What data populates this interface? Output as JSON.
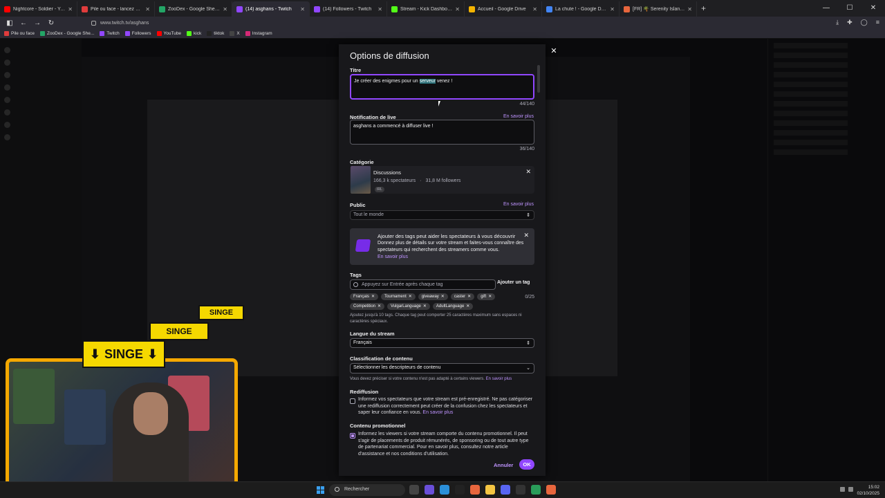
{
  "browser": {
    "tabs": [
      {
        "title": "Nightcore - Soldier - YouTu",
        "color": "#ff0000"
      },
      {
        "title": "Pile ou face - lancez une pièce",
        "color": "#e03c3c"
      },
      {
        "title": "ZooDex - Google Sheets",
        "color": "#23a566"
      },
      {
        "title": "(14) asghans - Twitch",
        "color": "#9147ff",
        "active": true
      },
      {
        "title": "(14) Followers - Twitch",
        "color": "#9147ff"
      },
      {
        "title": "Stream - Kick Dashboard",
        "color": "#53fc18"
      },
      {
        "title": "Accueil - Google Drive",
        "color": "#f4b400"
      },
      {
        "title": "La chute ! - Google Docs",
        "color": "#4285f4"
      },
      {
        "title": "[FR] 🌴 Serenity Island 🌴 | EI",
        "color": "#e8663d"
      }
    ],
    "url": "www.twitch.tv/asghans",
    "bookmarks": [
      {
        "label": "Pile ou face",
        "color": "#e03c3c"
      },
      {
        "label": "ZooDex - Google She...",
        "color": "#23a566"
      },
      {
        "label": "Twitch",
        "color": "#9147ff"
      },
      {
        "label": "Followers",
        "color": "#9147ff"
      },
      {
        "label": "YouTube",
        "color": "#ff0000"
      },
      {
        "label": "kick",
        "color": "#53fc18"
      },
      {
        "label": "tiktok",
        "color": "#222222"
      },
      {
        "label": "X",
        "color": "#444444"
      },
      {
        "label": "Instagram",
        "color": "#d62976"
      }
    ]
  },
  "overlay": {
    "singe_label": "SINGE"
  },
  "modal": {
    "title": "Options de diffusion",
    "title_field": {
      "label": "Titre",
      "value_before": "Je créer des enigmes pour un ",
      "value_highlight": "serveur",
      "value_after": " venez !",
      "counter": "44/140"
    },
    "notification": {
      "label": "Notification de live",
      "link": "En savoir plus",
      "value": "asghans a commencé à diffuser live !",
      "counter": "36/140"
    },
    "category": {
      "label": "Catégorie",
      "name": "Discussions",
      "viewers": "166,3 k spectateurs",
      "followers": "31,8 M followers",
      "tag": "IRL"
    },
    "audience": {
      "label": "Public",
      "link": "En savoir plus",
      "value": "Tout le monde"
    },
    "promo": {
      "title": "Ajouter des tags peut aider les spectateurs à vous découvrir",
      "body": "Donnez plus de détails sur votre stream et faites-vous connaître des spectateurs qui recherchent des streamers comme vous.",
      "link": "En savoir plus"
    },
    "tags": {
      "label": "Tags",
      "placeholder": "Appuyez sur Entrée après chaque tag",
      "add_button": "Ajouter un tag",
      "counter": "0/25",
      "items": [
        "Français",
        "Tournament",
        "giveaway",
        "caster",
        "gift",
        "Competition",
        "VulgarLanguage",
        "AdultLanguage"
      ],
      "hint": "Ajoutez jusqu'à 10 tags. Chaque tag peut comporter 25 caractères maximum sans espaces ni caractères spéciaux."
    },
    "language": {
      "label": "Langue du stream",
      "value": "Français"
    },
    "classification": {
      "label": "Classification de contenu",
      "value": "Sélectionner les descripteurs de contenu",
      "hint": "Vous devez préciser si votre contenu n'est pas adapté à certains viewers.",
      "hint_link": "En savoir plus"
    },
    "rerun": {
      "label": "Rediffusion",
      "text": "Informez vos spectateurs que votre stream est pré-enregistré. Ne pas catégoriser une rediffusion correctement peut créer de la confusion chez les spectateurs et saper leur confiance en vous.",
      "link": "En savoir plus"
    },
    "branded": {
      "label": "Contenu promotionnel",
      "text": "Informez les viewers si votre stream comporte du contenu promotionnel. Il peut s'agir de placements de produit rémunérés, de sponsoring ou de tout autre type de partenariat commercial. Pour en savoir plus, consultez notre article d'assistance et nos conditions d'utilisation."
    },
    "cancel": "Annuler",
    "ok": "OK"
  },
  "taskbar": {
    "search": "Rechercher",
    "time": "15:02",
    "date": "02/10/2025"
  }
}
